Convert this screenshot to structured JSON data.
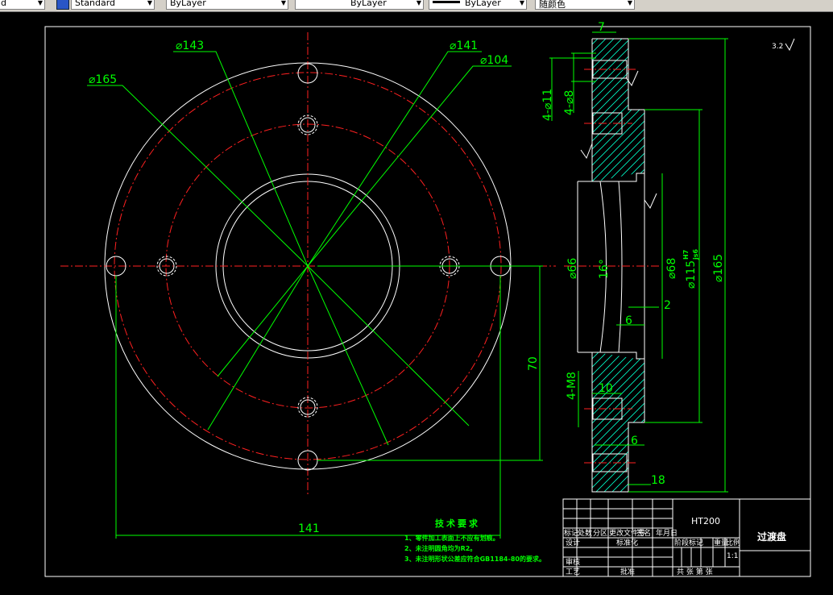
{
  "toolbar": {
    "combo1": "d",
    "combo2": "Standard",
    "combo3": "ByLayer",
    "combo4": "ByLayer",
    "combo5": "ByLayer",
    "combo6": "随颜色"
  },
  "dims": {
    "d143": "⌀143",
    "d141_top": "⌀141",
    "d104": "⌀104",
    "d165_left": "⌀165",
    "w141": "141",
    "v70": "70",
    "t7": "7",
    "h4d11": "4-⌀11",
    "h4d8": "4-⌀8",
    "d66": "⌀66",
    "a16": "16°",
    "d68": "⌀68",
    "d115": "⌀115",
    "fit_h7": "H7",
    "fit_js6": "js6",
    "d165_right": "⌀165",
    "s2": "2",
    "s6a": "6",
    "h4m8": "4-M8",
    "s10": "10",
    "s6b": "6",
    "s18": "18",
    "rough_corner": "3.2"
  },
  "notes": {
    "title": "技术要求",
    "line1": "1、零件加工表面上不应有划痕。",
    "line2": "2、未注明圆角均为R2。",
    "line3": "3、未注明形状公差应符合GB1184-80的要求。"
  },
  "titleblock": {
    "material": "HT200",
    "part_name": "过渡盘",
    "c_biaoji": "标记",
    "c_chushu": "处数",
    "c_fenqu": "分区",
    "c_gengai": "更改文件号",
    "c_qianming": "签名",
    "c_riqi": "年月日",
    "c_sheji": "设计",
    "c_biaozhunhua": "标准化",
    "c_jieduan": "阶段标记",
    "c_zhongliang": "重量",
    "c_bili": "比例",
    "c_shenhe": "审核",
    "c_gongyi": "工艺",
    "c_pizhun": "批准",
    "c_scale": "1:1",
    "c_gong": "共 张 第 张"
  }
}
